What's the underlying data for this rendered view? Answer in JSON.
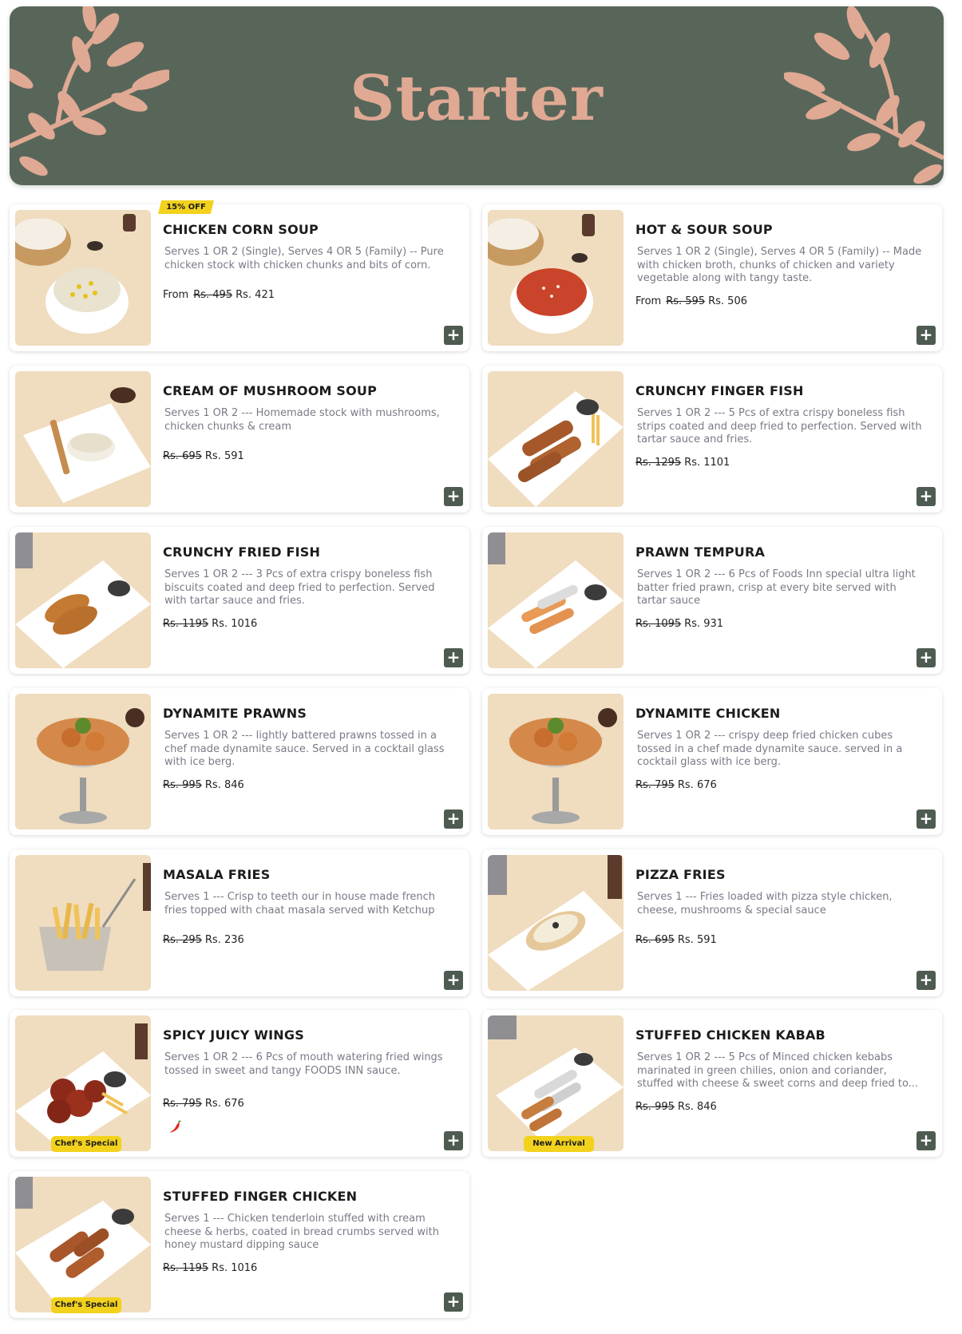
{
  "page": {
    "title": "Starter",
    "colors": {
      "banner": "#58665a",
      "accent": "#e0a993",
      "button": "#4e5b50",
      "badge": "#f2d21c"
    }
  },
  "items": [
    {
      "title": "CHICKEN CORN SOUP",
      "desc": "Serves 1 OR 2 (Single), Serves 4 OR 5 (Family) -- Pure chicken stock with chicken chunks and bits of corn.",
      "from": "From",
      "old_price": "Rs. 495",
      "price": "Rs. 421",
      "badge_off": "15% OFF"
    },
    {
      "title": "HOT & SOUR SOUP",
      "desc": "Serves 1 OR 2 (Single), Serves 4 OR 5 (Family) -- Made with chicken broth, chunks of chicken and variety vegetable along with tangy taste.",
      "from": "From",
      "old_price": "Rs. 595",
      "price": "Rs. 506"
    },
    {
      "title": "CREAM OF MUSHROOM SOUP",
      "desc": "Serves 1 OR 2 --- Homemade stock with mushrooms, chicken chunks & cream",
      "old_price": "Rs. 695",
      "price": "Rs. 591"
    },
    {
      "title": "CRUNCHY FINGER FISH",
      "desc": "Serves 1 OR 2 --- 5 Pcs of extra crispy boneless fish strips coated and deep fried to perfection. Served with tartar sauce and fries.",
      "old_price": "Rs. 1295",
      "price": "Rs. 1101"
    },
    {
      "title": "CRUNCHY FRIED FISH",
      "desc": "Serves 1 OR 2 --- 3 Pcs of extra crispy boneless fish biscuits coated and deep fried to perfection. Served with tartar sauce and fries.",
      "old_price": "Rs. 1195",
      "price": "Rs. 1016"
    },
    {
      "title": "PRAWN TEMPURA",
      "desc": "Serves 1 OR 2 --- 6 Pcs of Foods Inn special ultra light batter fried prawn, crisp at every bite served with tartar sauce",
      "old_price": "Rs. 1095",
      "price": "Rs. 931"
    },
    {
      "title": "DYNAMITE PRAWNS",
      "desc": "Serves 1 OR 2 --- lightly battered prawns tossed in a chef made dynamite sauce. Served in a cocktail glass with ice berg.",
      "old_price": "Rs. 995",
      "price": "Rs. 846"
    },
    {
      "title": "DYNAMITE CHICKEN",
      "desc": "Serves 1 OR 2 --- crispy deep fried chicken cubes tossed in a chef made dynamite sauce. served in a cocktail glass with ice berg.",
      "old_price": "Rs. 795",
      "price": "Rs. 676"
    },
    {
      "title": "MASALA FRIES",
      "desc": "Serves 1 --- Crisp to teeth our in house made french fries topped with chaat masala served with Ketchup",
      "old_price": "Rs. 295",
      "price": "Rs. 236"
    },
    {
      "title": "PIZZA FRIES",
      "desc": "Serves 1 --- Fries loaded with pizza style chicken, cheese, mushrooms & special sauce",
      "old_price": "Rs. 695",
      "price": "Rs. 591"
    },
    {
      "title": "SPICY JUICY WINGS",
      "desc": "Serves 1 OR 2 --- 6 Pcs of mouth watering fried wings tossed in sweet and tangy FOODS INN sauce.",
      "old_price": "Rs. 795",
      "price": "Rs. 676",
      "tag": "Chef's Special",
      "spicy": true
    },
    {
      "title": "STUFFED CHICKEN KABAB",
      "desc": "Serves 1 OR 2 --- 5 Pcs of Minced chicken kebabs marinated in green chilies, onion and coriander, stuffed with cheese & sweet corns and deep fried to...",
      "old_price": "Rs. 995",
      "price": "Rs. 846",
      "tag": "New Arrival"
    },
    {
      "title": "STUFFED FINGER CHICKEN",
      "desc": "Serves 1 --- Chicken tenderloin stuffed with cream cheese & herbs, coated in bread crumbs served with honey mustard dipping sauce",
      "old_price": "Rs. 1195",
      "price": "Rs. 1016",
      "tag": "Chef's Special"
    }
  ],
  "icons": {
    "add": "plus-icon",
    "spicy": "chili-icon"
  },
  "add_label": "+"
}
